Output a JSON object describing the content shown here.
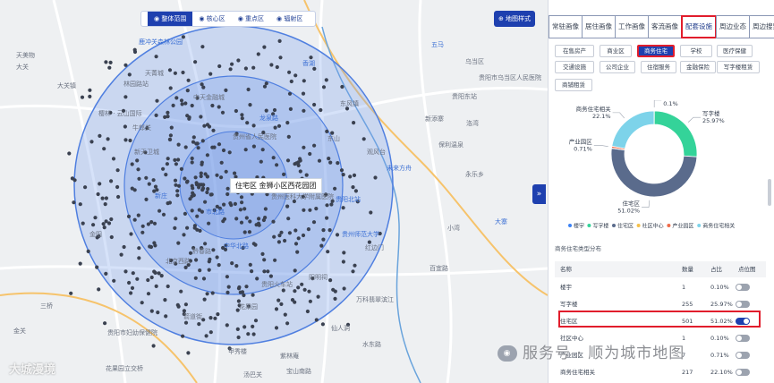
{
  "map": {
    "modes": [
      {
        "label": "整体范围",
        "active": true
      },
      {
        "label": "核心区",
        "active": false
      },
      {
        "label": "重点区",
        "active": false
      },
      {
        "label": "辐射区",
        "active": false
      }
    ],
    "map_style_label": "地图样式",
    "collapse_label": "»",
    "center_label": "住宅区 金狮小区西花园团",
    "place_labels": [
      "鹿冲关森林公园",
      "天美物",
      "大关",
      "大关镇",
      "林园路站",
      "香湖",
      "天菁城",
      "樱林 · 云山国际",
      "牛郎关",
      "新天卫城",
      "龙泉路",
      "东山",
      "中天金融城",
      "贵州省人民医院",
      "贵州医科大学附属医院",
      "贵阳北站",
      "贵阳东站",
      "东风镇",
      "金阳",
      "黔春路",
      "中华北路",
      "贵阳火车站",
      "花果园",
      "甲秀楼",
      "阳明祠",
      "贵州师范大学",
      "万科翡翠滨江",
      "贵阳市妇幼保健院",
      "花果园立交桥",
      "北京西路",
      "市北路",
      "宝山南路",
      "紫林庵",
      "仙人洞",
      "红边门",
      "未来方舟",
      "永乐乡",
      "小湾",
      "新添寨",
      "乌当区",
      "五马",
      "洛湾",
      "贵阳市乌当区人民医院",
      "保利温泉",
      "水东路",
      "大寨",
      "百宜路",
      "观风台",
      "箭道街",
      "汤巴关",
      "新庄",
      "三桥",
      "金关"
    ],
    "watermark_left": "大城漫境"
  },
  "panel": {
    "tabs": [
      {
        "label": "常驻画像",
        "active": false
      },
      {
        "label": "居住画像",
        "active": false
      },
      {
        "label": "工作画像",
        "active": false
      },
      {
        "label": "客流画像",
        "active": false
      },
      {
        "label": "配套设施",
        "active": true
      },
      {
        "label": "周边业态",
        "active": false
      },
      {
        "label": "周边搜索",
        "active": false
      }
    ],
    "chips": [
      {
        "label": "在售房产",
        "active": false
      },
      {
        "label": "商业区",
        "active": false
      },
      {
        "label": "商务住宅",
        "active": true
      },
      {
        "label": "学校",
        "active": false
      },
      {
        "label": "医疗保健",
        "active": false
      },
      {
        "label": "交通设施",
        "active": false
      },
      {
        "label": "公司企业",
        "active": false
      },
      {
        "label": "住宿服务",
        "active": false
      },
      {
        "label": "金融保险",
        "active": false
      },
      {
        "label": "写字楼租赁",
        "active": false
      },
      {
        "label": "商铺租赁",
        "active": false
      }
    ],
    "section_title": "商务住宅类型分布",
    "table_headers": {
      "name": "名称",
      "count": "数量",
      "share": "占比",
      "toggle": "点位图"
    },
    "highlight_row": "住宅区",
    "watermark_right": "服务号 · 顺为城市地图",
    "watermark_badge": "wechat-icon"
  },
  "chart_data": {
    "type": "pie",
    "donut": true,
    "categories": [
      "楼宇",
      "写字楼",
      "住宅区",
      "社区中心",
      "产业园区",
      "商务住宅相关"
    ],
    "values": [
      1,
      255,
      501,
      1,
      7,
      217
    ],
    "shares": [
      "0.10%",
      "25.97%",
      "51.02%",
      "0.10%",
      "0.71%",
      "22.10%"
    ],
    "slice_labels": [
      "楼宇\n0.1%",
      "写字楼\n25.97%",
      "住宅区\n51.02%",
      "社区中心",
      "产业园区\n0.71%",
      "商务住宅相关\n22.1%"
    ],
    "colors": [
      "#3b82f6",
      "#34d399",
      "#5a6b8c",
      "#f5c04a",
      "#ef6b4a",
      "#7dd3ea"
    ],
    "toggles": [
      false,
      false,
      true,
      false,
      false,
      false
    ],
    "legend": [
      "楼宇",
      "写字楼",
      "住宅区",
      "社区中心",
      "产业园区",
      "商务住宅相关"
    ],
    "legend_position": "bottom"
  }
}
